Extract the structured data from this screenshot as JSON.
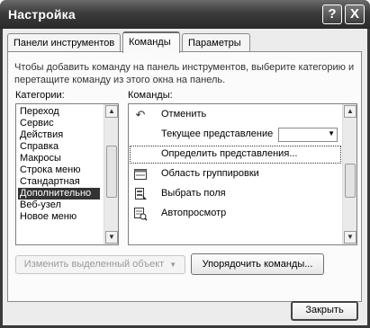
{
  "window": {
    "title": "Настройка",
    "help_glyph": "?",
    "close_glyph": "X"
  },
  "tabs": [
    {
      "label": "Панели инструментов",
      "active": false
    },
    {
      "label": "Команды",
      "active": true
    },
    {
      "label": "Параметры",
      "active": false
    }
  ],
  "description": "Чтобы добавить команду на панель инструментов, выберите категорию и перетащите команду из этого окна на панель.",
  "categories": {
    "label": "Категории:",
    "items": [
      "Переход",
      "Сервис",
      "Действия",
      "Справка",
      "Макросы",
      "Строка меню",
      "Стандартная",
      "Дополнительно",
      "Веб-узел",
      "Новое меню"
    ],
    "selected": "Дополнительно"
  },
  "commands": {
    "label": "Команды:",
    "items": [
      {
        "icon": "undo-icon",
        "label": "Отменить"
      },
      {
        "icon": "none",
        "label": "Текущее представление"
      },
      {
        "icon": "none",
        "label": "Определить представления..."
      },
      {
        "icon": "group-box-icon",
        "label": "Область группировки"
      },
      {
        "icon": "field-chooser-icon",
        "label": "Выбрать поля"
      },
      {
        "icon": "autopreview-icon",
        "label": "Автопросмотр"
      }
    ]
  },
  "buttons": {
    "modify_selection": "Изменить выделенный объект",
    "rearrange_commands": "Упорядочить команды...",
    "close": "Закрыть"
  }
}
